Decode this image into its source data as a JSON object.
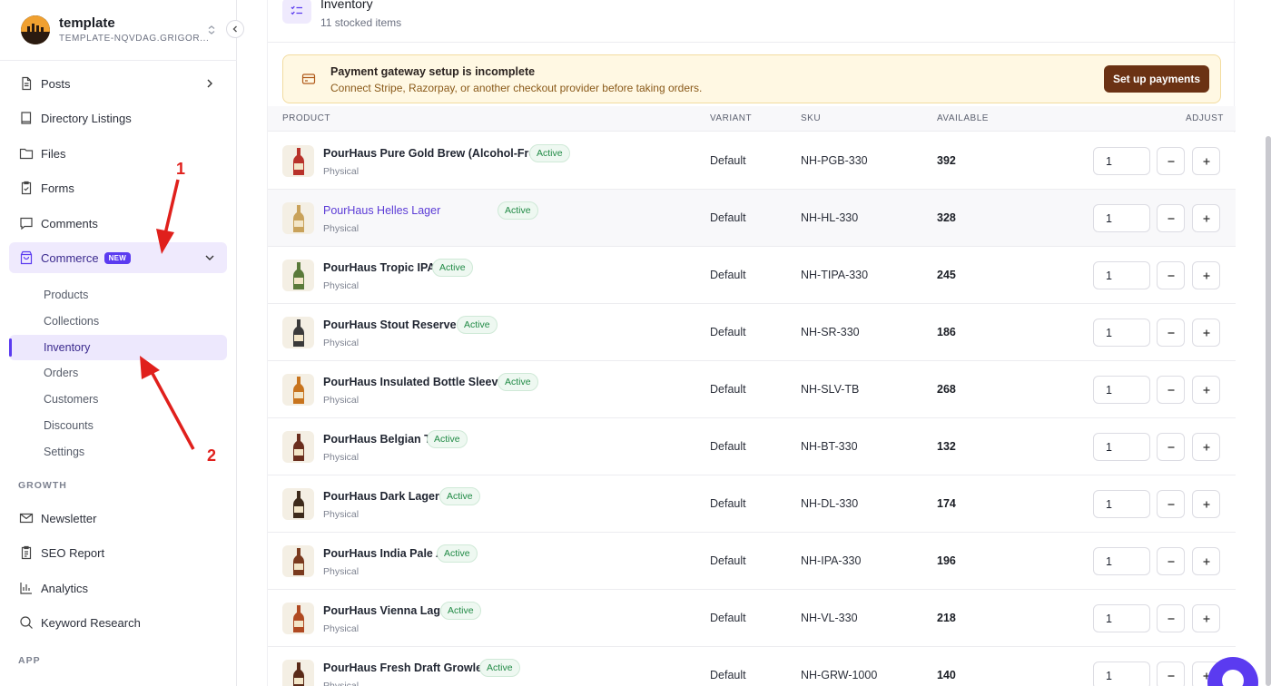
{
  "workspace": {
    "name": "template",
    "subtitle": "TEMPLATE-NQVDAG.GRIGOR..."
  },
  "sidebar": {
    "items": [
      {
        "label": "Posts",
        "icon": "document-icon"
      },
      {
        "label": "Directory Listings",
        "icon": "book-icon"
      },
      {
        "label": "Files",
        "icon": "folder-icon"
      },
      {
        "label": "Forms",
        "icon": "clipboard-icon"
      },
      {
        "label": "Comments",
        "icon": "comment-icon"
      },
      {
        "label": "Commerce",
        "icon": "shopping-bag-icon",
        "badge": "NEW"
      }
    ],
    "commerce_sub": [
      "Products",
      "Collections",
      "Inventory",
      "Orders",
      "Customers",
      "Discounts",
      "Settings"
    ],
    "growth_label": "GROWTH",
    "growth_items": [
      {
        "label": "Newsletter",
        "icon": "mail-icon"
      },
      {
        "label": "SEO Report",
        "icon": "report-icon"
      },
      {
        "label": "Analytics",
        "icon": "bar-chart-icon"
      },
      {
        "label": "Keyword Research",
        "icon": "search-icon"
      }
    ],
    "app_label": "APP"
  },
  "page": {
    "title": "Inventory",
    "subtitle": "11 stocked items"
  },
  "alert": {
    "title": "Payment gateway setup is incomplete",
    "text": "Connect Stripe, Razorpay, or another checkout provider before taking orders.",
    "button": "Set up payments"
  },
  "table": {
    "headers": {
      "product": "PRODUCT",
      "variant": "VARIANT",
      "sku": "SKU",
      "available": "AVAILABLE",
      "adjust": "ADJUST"
    },
    "rows": [
      {
        "name": "PourHaus Pure Gold Brew (Alcohol-Free)",
        "status": "Active",
        "type": "Physical",
        "variant": "Default",
        "sku": "NH-PGB-330",
        "available": "392",
        "qty": "1",
        "bottle": "#b8322a"
      },
      {
        "name": "PourHaus Helles Lager",
        "status": "Active",
        "type": "Physical",
        "variant": "Default",
        "sku": "NH-HL-330",
        "available": "328",
        "qty": "1",
        "bottle": "#c9a25a"
      },
      {
        "name": "PourHaus Tropic IPA",
        "status": "Active",
        "type": "Physical",
        "variant": "Default",
        "sku": "NH-TIPA-330",
        "available": "245",
        "qty": "1",
        "bottle": "#5a7a3a"
      },
      {
        "name": "PourHaus Stout Reserve",
        "status": "Active",
        "type": "Physical",
        "variant": "Default",
        "sku": "NH-SR-330",
        "available": "186",
        "qty": "1",
        "bottle": "#3a3a3a"
      },
      {
        "name": "PourHaus Insulated Bottle Sleeve",
        "status": "Active",
        "type": "Physical",
        "variant": "Default",
        "sku": "NH-SLV-TB",
        "available": "268",
        "qty": "1",
        "bottle": "#c8741e"
      },
      {
        "name": "PourHaus Belgian Tripel",
        "status": "Active",
        "type": "Physical",
        "variant": "Default",
        "sku": "NH-BT-330",
        "available": "132",
        "qty": "1",
        "bottle": "#6a2e1e"
      },
      {
        "name": "PourHaus Dark Lager",
        "status": "Active",
        "type": "Physical",
        "variant": "Default",
        "sku": "NH-DL-330",
        "available": "174",
        "qty": "1",
        "bottle": "#3d2a1a"
      },
      {
        "name": "PourHaus India Pale Ale",
        "status": "Active",
        "type": "Physical",
        "variant": "Default",
        "sku": "NH-IPA-330",
        "available": "196",
        "qty": "1",
        "bottle": "#7a3a1e"
      },
      {
        "name": "PourHaus Vienna Lager",
        "status": "Active",
        "type": "Physical",
        "variant": "Default",
        "sku": "NH-VL-330",
        "available": "218",
        "qty": "1",
        "bottle": "#b04a22"
      },
      {
        "name": "PourHaus Fresh Draft Growler",
        "status": "Active",
        "type": "Physical",
        "variant": "Default",
        "sku": "NH-GRW-1000",
        "available": "140",
        "qty": "1",
        "bottle": "#5a2a18"
      }
    ]
  },
  "annotations": {
    "one": "1",
    "two": "2"
  },
  "colors": {
    "accent": "#5b3bf0",
    "active_bg": "#efeafd",
    "alert_bg": "#fff8e3",
    "alert_button": "#6b3214",
    "status_green": "#208a45",
    "arrow": "#e0201c"
  }
}
